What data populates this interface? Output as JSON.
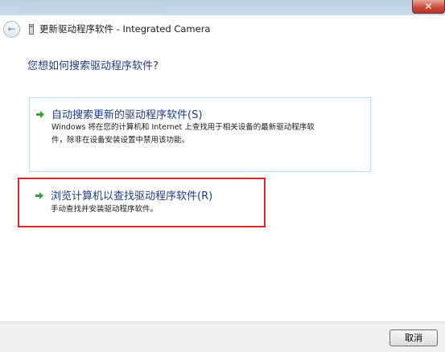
{
  "window": {
    "close_label": "✕"
  },
  "nav": {
    "back_glyph": "←",
    "title": "更新驱动程序软件 - Integrated Camera"
  },
  "main": {
    "question": "您想如何搜索驱动程序软件?",
    "options": [
      {
        "title": "自动搜索更新的驱动程序软件(S)",
        "description_line1": "Windows 将在您的计算机和 Internet 上查找用于相关设备的最新驱动程序软",
        "description_line2": "件，除非在设备安装设置中禁用该功能。",
        "icon": "green-arrow-icon"
      },
      {
        "title": "浏览计算机以查找驱动程序软件(R)",
        "description_line1": "手动查找并安装驱动程序软件。",
        "icon": "green-arrow-icon"
      }
    ]
  },
  "footer": {
    "cancel_label": "取消"
  },
  "colors": {
    "heading": "#1e3d82",
    "option_title": "#1c3c86",
    "option_border": "#b6e2ec",
    "highlight": "#e02424",
    "arrow": "#2fa52f"
  }
}
